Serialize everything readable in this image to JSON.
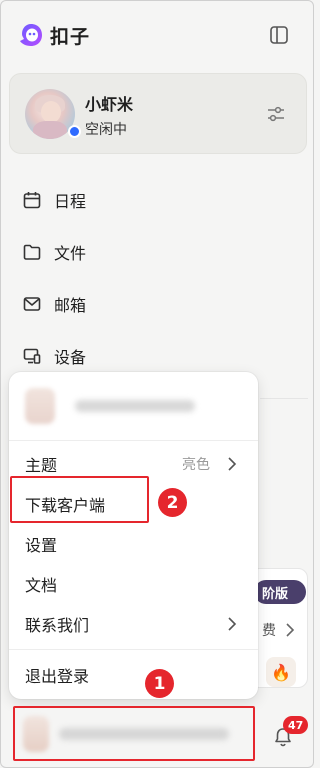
{
  "app": {
    "name": "扣子"
  },
  "profile": {
    "name": "小虾米",
    "status": "空闲中"
  },
  "nav": {
    "items": [
      {
        "label": "日程",
        "icon": "calendar-icon"
      },
      {
        "label": "文件",
        "icon": "folder-icon"
      },
      {
        "label": "邮箱",
        "icon": "mail-icon"
      },
      {
        "label": "设备",
        "icon": "device-icon"
      }
    ]
  },
  "background": {
    "plan_badge": "阶版",
    "fee_label": "费"
  },
  "menu": {
    "theme": {
      "label": "主题",
      "hint": "亮色"
    },
    "download": {
      "label": "下载客户端"
    },
    "settings": {
      "label": "设置"
    },
    "docs": {
      "label": "文档"
    },
    "contact": {
      "label": "联系我们"
    },
    "logout": {
      "label": "退出登录"
    }
  },
  "annotations": {
    "step_one": "1",
    "step_two": "2"
  },
  "notifications": {
    "count": "47"
  },
  "colors": {
    "annotation_red": "#e5262d",
    "status_blue": "#2f6bff",
    "card_bg": "#ebebe8"
  }
}
